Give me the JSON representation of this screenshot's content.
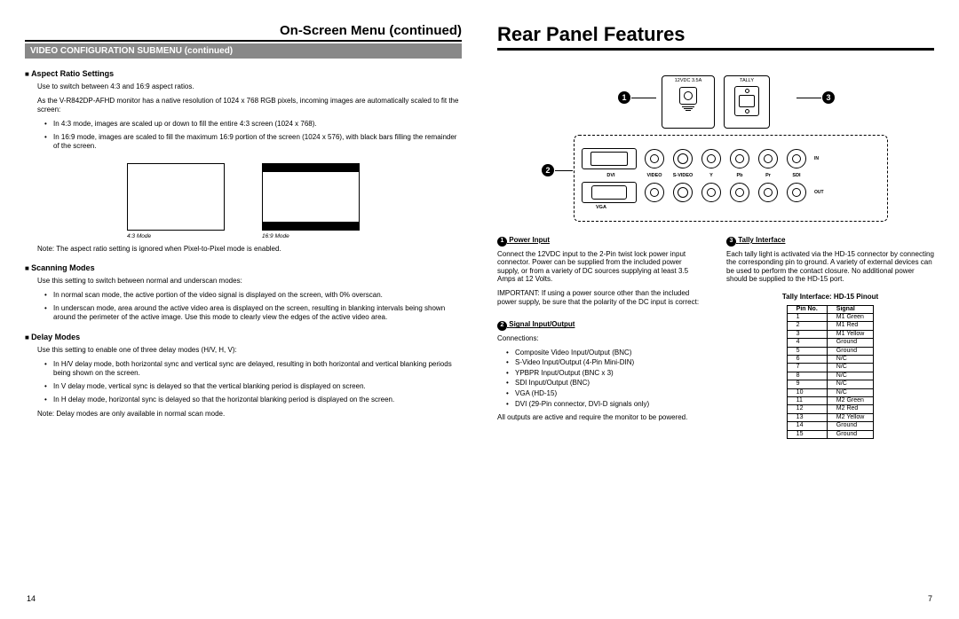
{
  "left": {
    "top_title": "On-Screen Menu (continued)",
    "subband": "VIDEO CONFIGURATION SUBMENU (continued)",
    "aspect": {
      "heading": "Aspect Ratio Settings",
      "intro": "Use to switch between 4:3 and 16:9 aspect ratios.",
      "para": "As the V-R842DP-AFHD monitor has a native resolution of 1024 x 768 RGB pixels, incoming images are automatically scaled to fit the screen:",
      "bullets": [
        "In 4:3 mode, images are scaled up or down to fill the entire 4:3 screen (1024 x 768).",
        "In 16:9 mode, images are scaled to fill the maximum 16:9 portion of the screen (1024 x 576), with black bars filling the remainder of the screen."
      ],
      "caption43": "4:3 Mode",
      "caption169": "16:9 Mode",
      "note": "Note: The aspect ratio setting is ignored when Pixel-to-Pixel mode is enabled."
    },
    "scanning": {
      "heading": "Scanning Modes",
      "intro": "Use this setting to switch between normal and underscan modes:",
      "bullets": [
        "In normal scan mode, the active portion of the video signal is displayed on the screen, with 0% overscan.",
        "In underscan mode, area around the active video area is displayed on the screen, resulting in blanking intervals being shown around the perimeter of the active image. Use this mode to clearly view the edges of the active video area."
      ]
    },
    "delay": {
      "heading": "Delay Modes",
      "intro": "Use this setting to enable one of three delay modes (H/V, H, V):",
      "bullets": [
        "In H/V delay mode, both horizontal sync and vertical sync are delayed, resulting in both horizontal and vertical blanking periods being shown on the screen.",
        "In V delay mode, vertical sync is delayed so that the vertical blanking period is displayed on screen.",
        "In H delay mode, horizontal sync is delayed so that the horizontal blanking period is displayed on the screen."
      ],
      "note": "Note: Delay modes are only available in normal scan mode."
    },
    "pagenum": "14"
  },
  "right": {
    "title": "Rear Panel Features",
    "diagram": {
      "power_label": "12VDC\n3.5A",
      "tally_label": "TALLY",
      "conn_labels": [
        "DVI",
        "VIDEO",
        "S-VIDEO",
        "Y",
        "Pb",
        "Pr",
        "SDI"
      ],
      "vga_label": "VGA",
      "in_label": "IN",
      "out_label": "OUT"
    },
    "power": {
      "heading": "Power Input",
      "p1": "Connect the 12VDC input to the 2-Pin twist lock power input connector. Power can be supplied from the included power supply, or from a variety of DC sources supplying at least 3.5 Amps at 12 Volts.",
      "p2": "IMPORTANT: If using a power source other than the included power supply, be sure that the polarity of the DC input is correct:"
    },
    "signal": {
      "heading": "Signal Input/Output",
      "p1": "Connections:",
      "bullets": [
        "Composite Video Input/Output (BNC)",
        "S-Video Input/Output (4-Pin Mini-DIN)",
        "YPBPR Input/Output (BNC x 3)",
        "SDI Input/Output (BNC)",
        "VGA (HD-15)",
        "DVI (29-Pin connector, DVI-D signals only)"
      ],
      "p2": "All outputs are active and require the monitor to be powered."
    },
    "tally": {
      "heading": "Tally Interface",
      "p1": "Each tally light is activated via the HD-15 connector by connecting the corresponding pin to ground. A variety of external devices can be used to perform the contact closure. No additional power should be supplied to the HD-15 port.",
      "pinout_title": "Tally Interface: HD-15 Pinout",
      "table_head": [
        "Pin No.",
        "Signal"
      ],
      "table_rows": [
        [
          "1",
          "M1 Green"
        ],
        [
          "2",
          "M1 Red"
        ],
        [
          "3",
          "M1 Yellow"
        ],
        [
          "4",
          "Ground"
        ],
        [
          "5",
          "Ground"
        ],
        [
          "6",
          "N/C"
        ],
        [
          "7",
          "N/C"
        ],
        [
          "8",
          "N/C"
        ],
        [
          "9",
          "N/C"
        ],
        [
          "10",
          "N/C"
        ],
        [
          "11",
          "M2 Green"
        ],
        [
          "12",
          "M2 Red"
        ],
        [
          "13",
          "M2 Yellow"
        ],
        [
          "14",
          "Ground"
        ],
        [
          "15",
          "Ground"
        ]
      ]
    },
    "pagenum": "7"
  }
}
